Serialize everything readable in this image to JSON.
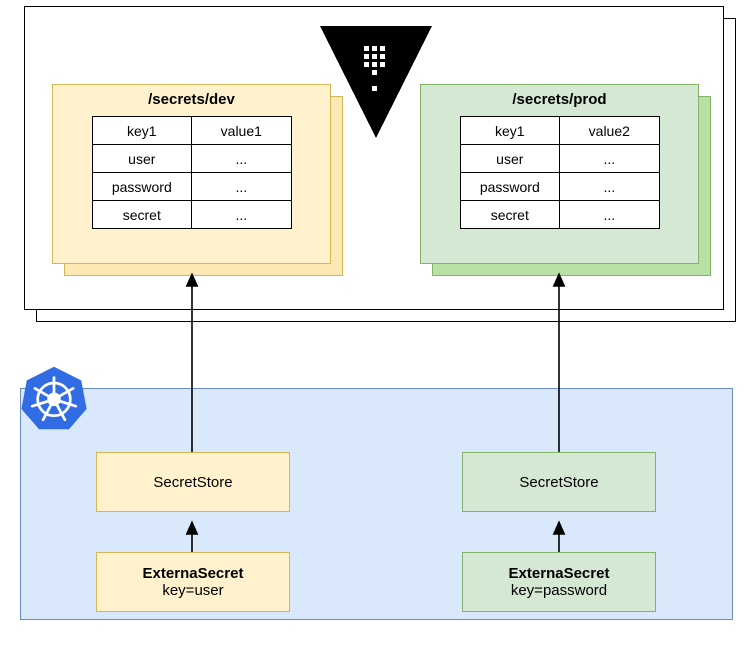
{
  "dev": {
    "title": "/secrets/dev",
    "rows": [
      {
        "k": "key1",
        "v": "value1"
      },
      {
        "k": "user",
        "v": "..."
      },
      {
        "k": "password",
        "v": "..."
      },
      {
        "k": "secret",
        "v": "..."
      }
    ]
  },
  "prod": {
    "title": "/secrets/prod",
    "rows": [
      {
        "k": "key1",
        "v": "value2"
      },
      {
        "k": "user",
        "v": "..."
      },
      {
        "k": "password",
        "v": "..."
      },
      {
        "k": "secret",
        "v": "..."
      }
    ]
  },
  "devStore": {
    "label": "SecretStore"
  },
  "prodStore": {
    "label": "SecretStore"
  },
  "devExtSec": {
    "title": "ExternaSecret",
    "sub": "key=user"
  },
  "prodExtSec": {
    "title": "ExternaSecret",
    "sub": "key=password"
  },
  "icons": {
    "vault": "vault-logo",
    "k8s": "kubernetes-logo"
  }
}
